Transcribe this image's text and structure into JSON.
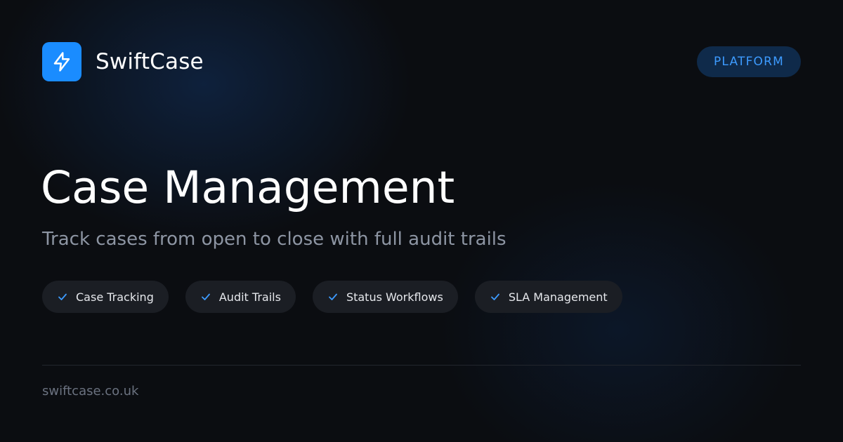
{
  "brand": {
    "name": "SwiftCase",
    "logo_icon": "lightning-bolt-icon",
    "accent_color": "#1a8cff"
  },
  "badge": {
    "label": "PLATFORM"
  },
  "hero": {
    "title": "Case Management",
    "subtitle": "Track cases from open to close with full audit trails"
  },
  "features": [
    {
      "icon": "check-icon",
      "label": "Case Tracking"
    },
    {
      "icon": "check-icon",
      "label": "Audit Trails"
    },
    {
      "icon": "check-icon",
      "label": "Status Workflows"
    },
    {
      "icon": "check-icon",
      "label": "SLA Management"
    }
  ],
  "footer": {
    "url": "swiftcase.co.uk"
  },
  "colors": {
    "background": "#0b0d11",
    "badge_background": "#0f2a4a",
    "badge_text": "#3d9bff",
    "chip_background": "#1b1e24",
    "subtitle_text": "#8d95a3",
    "footer_text": "#6b7280"
  }
}
